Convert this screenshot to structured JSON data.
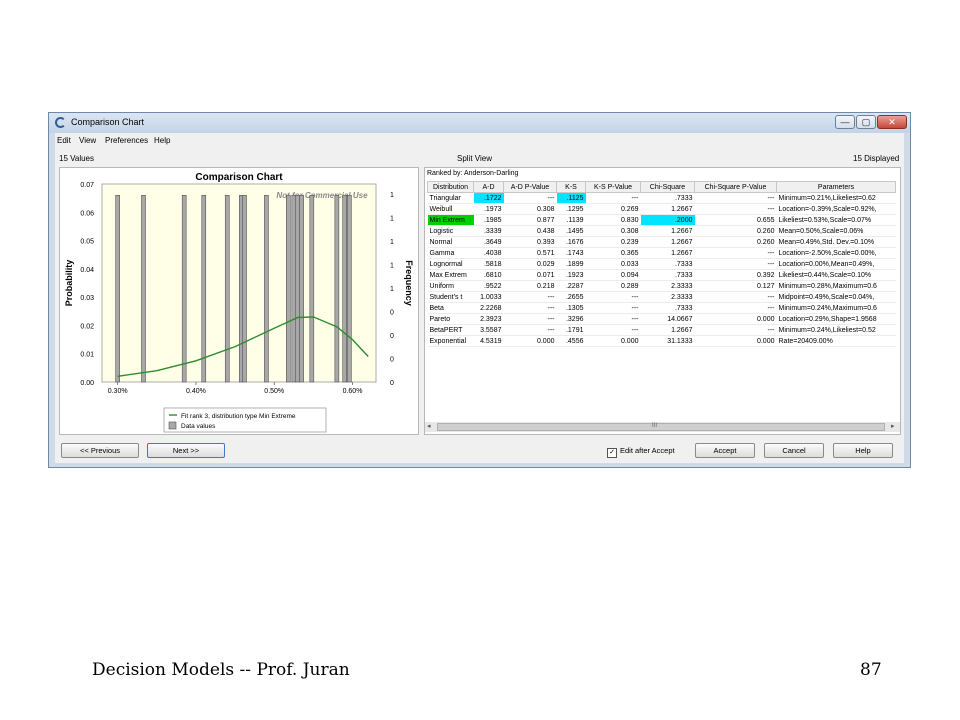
{
  "window": {
    "title": "Comparison Chart",
    "minimize": "—",
    "maximize": "▢",
    "close": "✕"
  },
  "menu": [
    "Edit",
    "View",
    "Preferences",
    "Help"
  ],
  "info": {
    "left": "15 Values",
    "center": "Split View",
    "right": "15 Displayed"
  },
  "chart_data": {
    "type": "bar",
    "title": "Comparison Chart",
    "ylabel": "Probability",
    "y2label": "Frequency",
    "ylim": [
      0,
      0.07
    ],
    "yticks": [
      "0.07",
      "0.06",
      "0.05",
      "0.04",
      "0.03",
      "0.02",
      "0.01",
      "0.00"
    ],
    "y2ticks": [
      "1",
      "1",
      "1",
      "1",
      "1",
      "0",
      "0",
      "0",
      "0"
    ],
    "xlim": [
      0.0028,
      0.0063
    ],
    "xticks": [
      {
        "value": 0.003,
        "label": "0.30%"
      },
      {
        "value": 0.004,
        "label": "0.40%"
      },
      {
        "value": 0.005,
        "label": "0.50%"
      },
      {
        "value": 0.006,
        "label": "0.60%"
      }
    ],
    "watermark": "Not for Commercial Use",
    "series": [
      {
        "name": "Data values",
        "type": "bar",
        "x": [
          0.003,
          0.00333,
          0.00385,
          0.0041,
          0.0044,
          0.00458,
          0.00462,
          0.0049,
          0.00518,
          0.00525,
          0.0053,
          0.00535,
          0.00548,
          0.0058,
          0.0059,
          0.00596
        ],
        "values": [
          0.066,
          0.066,
          0.066,
          0.066,
          0.066,
          0.066,
          0.066,
          0.066,
          0.066,
          0.066,
          0.066,
          0.066,
          0.066,
          0.066,
          0.066,
          0.066
        ]
      },
      {
        "name": "Fit rank 3, distribution type Min Extreme",
        "type": "line",
        "x": [
          0.003,
          0.0035,
          0.004,
          0.0045,
          0.005,
          0.0053,
          0.0055,
          0.0058,
          0.006,
          0.0062
        ],
        "values": [
          0.002,
          0.004,
          0.0075,
          0.0125,
          0.019,
          0.0228,
          0.023,
          0.0195,
          0.015,
          0.009
        ]
      }
    ],
    "legend": [
      "Fit rank 3, distribution type Min Extreme",
      "Data values"
    ],
    "legend_position": "bottom"
  },
  "table": {
    "ranked_by": "Ranked by: Anderson-Darling",
    "headers": [
      "Distribution",
      "A-D",
      "A-D P-Value",
      "K-S",
      "K-S P-Value",
      "Chi-Square",
      "Chi-Square P-Value",
      "Parameters"
    ],
    "rows": [
      [
        "Triangular",
        ".1722",
        "---",
        ".1125",
        "---",
        ".7333",
        "---",
        "Minimum=0.21%,Likeliest=0.62"
      ],
      [
        "Weibull",
        ".1973",
        "0.308",
        ".1295",
        "0.269",
        "1.2667",
        "---",
        "Location=-0.39%,Scale=0.92%,"
      ],
      [
        "Min Extrem",
        ".1985",
        "0.877",
        ".1139",
        "0.830",
        ".2000",
        "0.655",
        "Likeliest=0.53%,Scale=0.07%"
      ],
      [
        "Logistic",
        ".3339",
        "0.438",
        ".1495",
        "0.308",
        "1.2667",
        "0.260",
        "Mean=0.50%,Scale=0.06%"
      ],
      [
        "Normal",
        ".3649",
        "0.393",
        ".1676",
        "0.239",
        "1.2667",
        "0.260",
        "Mean=0.49%,Std. Dev.=0.10%"
      ],
      [
        "Gamma",
        ".4038",
        "0.571",
        ".1743",
        "0.365",
        "1.2667",
        "---",
        "Location=-2.50%,Scale=0.00%,"
      ],
      [
        "Lognormal",
        ".5818",
        "0.029",
        ".1899",
        "0.033",
        ".7333",
        "---",
        "Location=0.00%,Mean=0.49%,"
      ],
      [
        "Max Extrem",
        ".6810",
        "0.071",
        ".1923",
        "0.094",
        ".7333",
        "0.392",
        "Likeliest=0.44%,Scale=0.10%"
      ],
      [
        "Uniform",
        ".9522",
        "0.218",
        ".2287",
        "0.289",
        "2.3333",
        "0.127",
        "Minimum=0.28%,Maximum=0.6"
      ],
      [
        "Student's t",
        "1.0033",
        "---",
        ".2655",
        "---",
        "2.3333",
        "---",
        "Midpoint=0.49%,Scale=0.04%,"
      ],
      [
        "Beta",
        "2.2268",
        "---",
        ".1305",
        "---",
        ".7333",
        "---",
        "Minimum=0.24%,Maximum=0.6"
      ],
      [
        "Pareto",
        "2.3923",
        "---",
        ".3296",
        "---",
        "14.0667",
        "0.000",
        "Location=0.29%,Shape=1.9568"
      ],
      [
        "BetaPERT",
        "3.5587",
        "---",
        ".1791",
        "---",
        "1.2667",
        "---",
        "Minimum=0.24%,Likeliest=0.52"
      ],
      [
        "Exponential",
        "4.5319",
        "0.000",
        ".4556",
        "0.000",
        "31.1333",
        "0.000",
        "Rate=20409.00%"
      ]
    ],
    "highlight_colors": {
      "cyan": "#00e5ff",
      "green": "#00d000"
    }
  },
  "scrollbar": {
    "left": "◂",
    "thumb": "III",
    "right": "▸"
  },
  "buttons": {
    "previous": "<< Previous",
    "next": "Next >>",
    "edit_after_accept": "Edit after Accept",
    "accept": "Accept",
    "cancel": "Cancel",
    "help": "Help"
  },
  "footer": {
    "left": "Decision Models -- Prof. Juran",
    "page": "87"
  }
}
